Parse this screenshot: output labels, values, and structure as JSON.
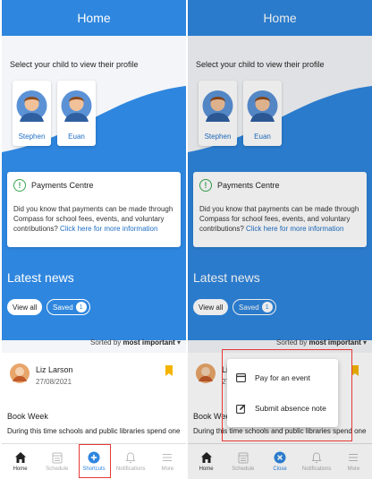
{
  "header": {
    "title": "Home"
  },
  "children_section": {
    "prompt": "Select your child to view their profile",
    "children": [
      {
        "name": "Stephen"
      },
      {
        "name": "Euan"
      }
    ]
  },
  "payments": {
    "title": "Payments Centre",
    "text": "Did you know that payments can be made through Compass for school fees, events, and voluntary contributions?",
    "link": "Click here for more information"
  },
  "news": {
    "title": "Latest news",
    "view_all": "View all",
    "saved_label": "Saved",
    "saved_count": "1",
    "sorted_prefix": "Sorted by",
    "sorted_value": "most important",
    "post": {
      "author": "Liz Larson",
      "date": "27/08/2021",
      "title": "Book Week",
      "body": "During this time schools and public libraries spend one"
    }
  },
  "tabbar_left": [
    {
      "label": "Home",
      "icon": "home-icon"
    },
    {
      "label": "Schedule",
      "icon": "calendar-icon"
    },
    {
      "label": "Shortcuts",
      "icon": "plus-circle-icon"
    },
    {
      "label": "Notifications",
      "icon": "bell-icon"
    },
    {
      "label": "More",
      "icon": "menu-icon"
    }
  ],
  "tabbar_right": [
    {
      "label": "Home",
      "icon": "home-icon"
    },
    {
      "label": "Schedule",
      "icon": "calendar-icon"
    },
    {
      "label": "Close",
      "icon": "close-circle-icon"
    },
    {
      "label": "Notifications",
      "icon": "bell-icon"
    },
    {
      "label": "More",
      "icon": "menu-icon"
    }
  ],
  "popup": {
    "items": [
      {
        "label": "Pay for an event",
        "icon": "card-icon"
      },
      {
        "label": "Submit absence note",
        "icon": "note-edit-icon"
      }
    ]
  },
  "colors": {
    "primary": "#2e86de",
    "highlight": "#e53935",
    "bookmark": "#f4b400",
    "success": "#3aa655"
  }
}
